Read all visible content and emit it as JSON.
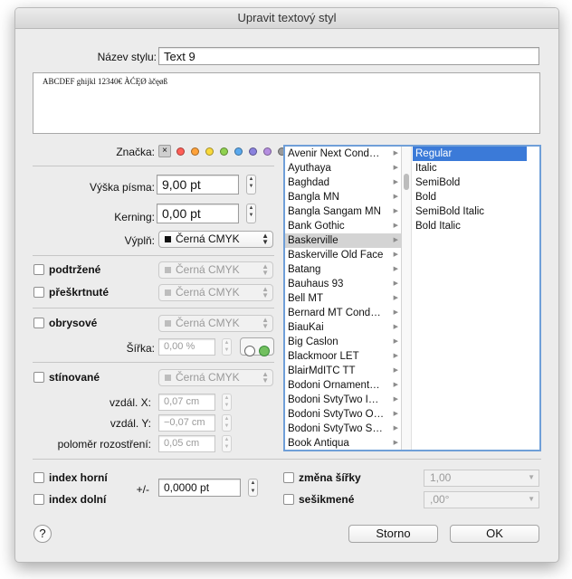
{
  "window": {
    "title": "Upravit textový styl"
  },
  "style_name": {
    "label": "Název stylu:",
    "value": "Text 9"
  },
  "preview": {
    "text": "ABCDEF ghijkl 12340€ ÀĆĘØ àčęøß"
  },
  "marker": {
    "label": "Značka:",
    "dot_colors": [
      "#ff5f57",
      "#ffa23a",
      "#f9d93c",
      "#8fd14f",
      "#5aa9ee",
      "#8a82de",
      "#b58ee0",
      "#9a9a9a"
    ]
  },
  "font_size": {
    "label": "Výška písma:",
    "value": "9,00 pt"
  },
  "kerning": {
    "label": "Kerning:",
    "value": "0,00 pt"
  },
  "fill": {
    "label": "Výplň:",
    "value": "Černá CMYK"
  },
  "underline": {
    "label": "podtržené",
    "value": "Černá CMYK"
  },
  "strikethrough": {
    "label": "přeškrtnuté",
    "value": "Černá CMYK"
  },
  "outline": {
    "label": "obrysové",
    "value": "Černá CMYK",
    "width_label": "Šířka:",
    "width_value": "0,00 %"
  },
  "shadow": {
    "label": "stínované",
    "value": "Černá CMYK",
    "dx_label": "vzdál. X:",
    "dx_value": "0,07 cm",
    "dy_label": "vzdál. Y:",
    "dy_value": "−0,07 cm",
    "blur_label": "poloměr rozostření:",
    "blur_value": "0,05 cm"
  },
  "fonts": {
    "families": [
      "Avenir Next Cond…",
      "Ayuthaya",
      "Baghdad",
      "Bangla MN",
      "Bangla Sangam MN",
      "Bank Gothic",
      "Baskerville",
      "Baskerville Old Face",
      "Batang",
      "Bauhaus 93",
      "Bell MT",
      "Bernard MT Cond…",
      "BiauKai",
      "Big Caslon",
      "Blackmoor LET",
      "BlairMdITC TT",
      "Bodoni Ornament…",
      "Bodoni SvtyTwo I…",
      "Bodoni SvtyTwo O…",
      "Bodoni SvtyTwo S…",
      "Book Antiqua"
    ],
    "selected_family": "Baskerville",
    "styles": [
      "Regular",
      "Italic",
      "SemiBold",
      "Bold",
      "SemiBold Italic",
      "Bold Italic"
    ],
    "selected_style": "Regular"
  },
  "superscript": {
    "label": "index horní"
  },
  "subscript": {
    "label": "index dolní"
  },
  "offset": {
    "label": "+/-",
    "value": "0,0000 pt"
  },
  "width_change": {
    "label": "změna šířky",
    "value": "1,00"
  },
  "skew": {
    "label": "sešikmené",
    "value": ",00°"
  },
  "buttons": {
    "help": "?",
    "cancel": "Storno",
    "ok": "OK"
  }
}
